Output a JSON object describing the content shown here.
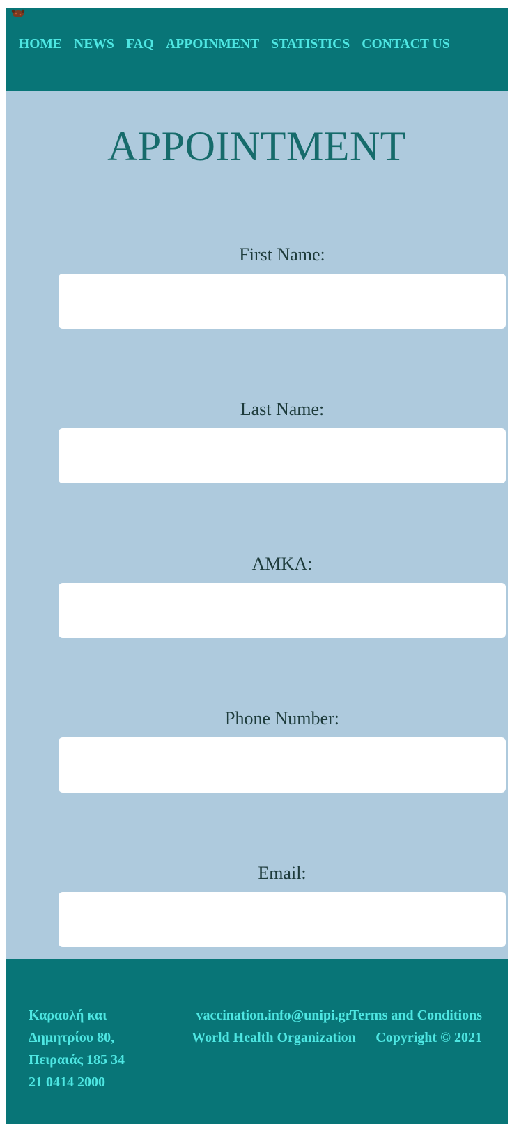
{
  "header": {
    "logo_icon": "virus-logo-icon",
    "nav": [
      {
        "label": "HOME"
      },
      {
        "label": "NEWS"
      },
      {
        "label": "FAQ"
      },
      {
        "label": "APPOINMENT"
      },
      {
        "label": "STATISTICS"
      },
      {
        "label": "CONTACT US"
      }
    ]
  },
  "main": {
    "title": "APPOINTMENT",
    "fields": [
      {
        "label": "First Name:",
        "value": "",
        "placeholder": ""
      },
      {
        "label": "Last Name:",
        "value": "",
        "placeholder": ""
      },
      {
        "label": "AMKA:",
        "value": "",
        "placeholder": ""
      },
      {
        "label": "Phone Number:",
        "value": "",
        "placeholder": ""
      },
      {
        "label": "Email:",
        "value": "",
        "placeholder": ""
      }
    ]
  },
  "footer": {
    "address": [
      "Καραολή και",
      "Δημητρίου 80,",
      "Πειραιάς 185 34",
      "21 0414 2000"
    ],
    "email": "vaccination.info@unipi.gr",
    "who": "World Health Organization",
    "terms": "Terms and Conditions",
    "copyright": "Copyright © 2021"
  },
  "colors": {
    "header_bg": "#087577",
    "nav_text": "#4ee6e2",
    "main_bg": "#aecadd",
    "title": "#166b6b"
  }
}
